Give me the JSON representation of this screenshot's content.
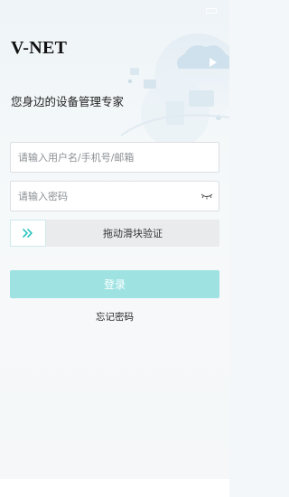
{
  "app": {
    "title": "V-NET",
    "subtitle": "您身边的设备管理专家"
  },
  "login_form": {
    "username_placeholder": "请输入用户名/手机号/邮箱",
    "password_placeholder": "请输入密码",
    "slider_label": "拖动滑块验证",
    "login_label": "登录",
    "forgot_label": "忘记密码"
  },
  "icons": {
    "slider_handle": "double-chevron-right-icon",
    "password_toggle": "eye-closed-icon"
  },
  "colors": {
    "accent": "#2ec4c2",
    "login_button": "#9ee3e2"
  }
}
